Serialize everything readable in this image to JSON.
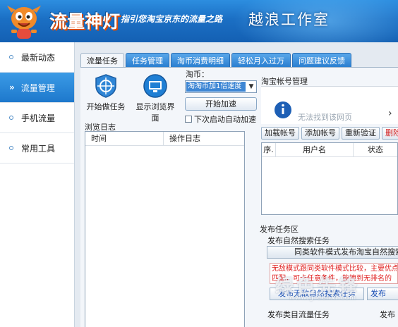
{
  "header": {
    "app_title": "流量神灯",
    "slogan": "指引您淘宝京东的流量之路",
    "studio": "越浪工作室"
  },
  "sidebar": {
    "items": [
      {
        "label": "最新动态",
        "active": false
      },
      {
        "label": "流量管理",
        "active": true
      },
      {
        "label": "手机流量",
        "active": false
      },
      {
        "label": "常用工具",
        "active": false
      }
    ]
  },
  "tabs": [
    {
      "label": "流量任务",
      "active": true
    },
    {
      "label": "任务管理",
      "active": false
    },
    {
      "label": "淘币消费明细",
      "active": false
    },
    {
      "label": "轻松月入过万",
      "active": false
    },
    {
      "label": "问题建议反馈",
      "active": false
    }
  ],
  "task": {
    "start_task_label": "开始做任务",
    "show_browser_label": "显示浏览界面",
    "taobi_label": "淘币：",
    "taobi_value": "淘淘币加1倍速度",
    "accel_label": "开始加速",
    "auto_accel_label": "下次启动自动加速",
    "log_title": "浏览日志",
    "log_columns": [
      "时间",
      "操作日志"
    ]
  },
  "account": {
    "title": "淘宝帐号管理",
    "error_text": "无法找到该网页",
    "buttons": [
      "加载帐号",
      "添加帐号",
      "重新验证",
      "删除帐"
    ],
    "columns": [
      "序.",
      "用户名",
      "状态"
    ]
  },
  "publish": {
    "title": "发布任务区",
    "natural_title": "发布自然搜索任务",
    "same_software_btn": "同类软件模式发布淘宝自然搜索任",
    "warning_line1": "无敌模式跟同类软件模式比较，主要优点",
    "warning_line2": "匹配，可卡任意条件，能拽到无排名的",
    "nopay_btn": "发布无敌自然搜索任务",
    "publish_btn2": "发布",
    "same_cat_title": "发布类目流量任务",
    "same_cat_title2": "发布"
  },
  "watermark": {
    "text": "绿色先锋",
    "url": "www.greenxf.com"
  },
  "colors": {
    "header_blue": "#1b6fc4",
    "active_blue": "#1d78cc",
    "warning_red": "#e02020",
    "link_blue": "#1a4fb5"
  }
}
